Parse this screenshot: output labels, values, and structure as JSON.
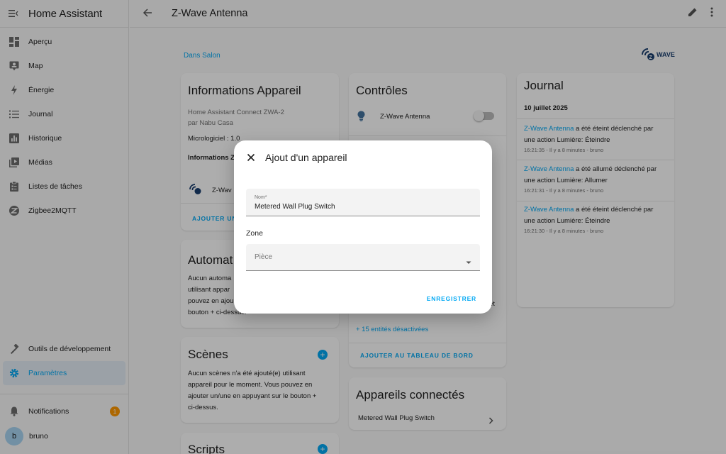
{
  "app": {
    "title": "Home Assistant"
  },
  "sidebar": {
    "items": [
      {
        "label": "Aperçu",
        "icon": "dashboard-icon"
      },
      {
        "label": "Map",
        "icon": "map-icon"
      },
      {
        "label": "Énergie",
        "icon": "lightning-icon"
      },
      {
        "label": "Journal",
        "icon": "list-icon"
      },
      {
        "label": "Historique",
        "icon": "chart-icon"
      },
      {
        "label": "Médias",
        "icon": "media-icon"
      },
      {
        "label": "Listes de tâches",
        "icon": "clipboard-icon"
      },
      {
        "label": "Zigbee2MQTT",
        "icon": "zigbee-icon"
      }
    ],
    "dev_tools": "Outils de développement",
    "settings": "Paramètres",
    "notifications": "Notifications",
    "notifications_count": "1",
    "user_initial": "b",
    "user_name": "bruno"
  },
  "header": {
    "title": "Z-Wave Antenna"
  },
  "breadcrumb": "Dans Salon",
  "logo_text": "WAVE",
  "device_info": {
    "title": "Informations Appareil",
    "model": "Home Assistant Connect ZWA-2",
    "maker": "par Nabu Casa",
    "firmware": "Micrologiciel : 1.0",
    "zwave_info": "Informations Z",
    "integration": "Z-Wav",
    "add_button": "AJOUTER UN"
  },
  "automations": {
    "title": "Automat",
    "text": [
      "Aucun automa",
      "utilisant appar",
      "pouvez en ajou",
      "bouton + ci-dessus."
    ]
  },
  "scenes": {
    "title": "Scènes",
    "text": [
      "Aucun scènes n'a été ajouté(e) utilisant",
      "appareil pour le moment. Vous pouvez en",
      "ajouter un/une en appuyant sur le bouton +",
      "ci-dessus."
    ]
  },
  "scripts": {
    "title": "Scripts"
  },
  "controls": {
    "title": "Contrôles",
    "entity": "Z-Wave Antenna",
    "partial_text": "ét",
    "disabled_entities": "+ 15 entités désactivées",
    "add_dashboard": "AJOUTER AU TABLEAU DE BORD"
  },
  "connected": {
    "title": "Appareils connectés",
    "item": "Metered Wall Plug Switch"
  },
  "journal": {
    "title": "Journal",
    "date": "10 juillet 2025",
    "entries": [
      {
        "link": "Z-Wave Antenna",
        "text1": " a été éteint déclenché par",
        "text2": "une action Lumière: Éteindre",
        "meta": "16:21:35 - Il y a 8 minutes - bruno"
      },
      {
        "link": "Z-Wave Antenna",
        "text1": " a été allumé déclenché par",
        "text2": "une action Lumière: Allumer",
        "meta": "16:21:31 - Il y a 8 minutes - bruno"
      },
      {
        "link": "Z-Wave Antenna",
        "text1": " a été éteint déclenché par",
        "text2": "une action Lumière: Éteindre",
        "meta": "16:21:30 - Il y a 8 minutes - bruno"
      }
    ]
  },
  "dialog": {
    "title": "Ajout d'un appareil",
    "name_label": "Nom*",
    "name_value": "Metered Wall Plug Switch",
    "zone_label": "Zone",
    "room_placeholder": "Pièce",
    "save": "ENREGISTRER"
  },
  "colors": {
    "accent": "#03a9f4",
    "badge": "#ff9800"
  }
}
